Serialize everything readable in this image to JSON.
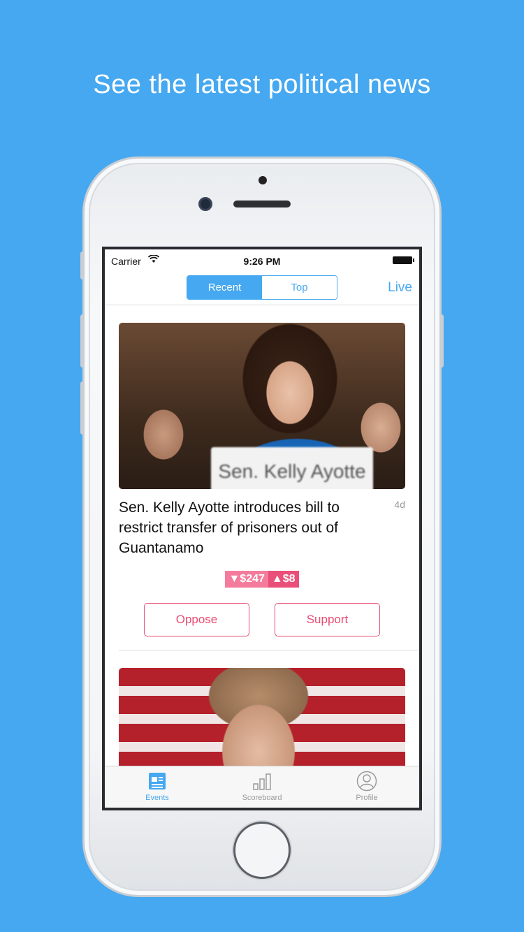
{
  "promo": {
    "headline": "See the latest political news"
  },
  "status_bar": {
    "carrier": "Carrier",
    "time": "9:26 PM"
  },
  "nav": {
    "segments": [
      "Recent",
      "Top"
    ],
    "selected": "Recent",
    "live_label": "Live"
  },
  "feed": [
    {
      "nameplate": "Sen. Kelly Ayotte",
      "title": "Sen. Kelly Ayotte introduces bill to restrict transfer of prisoners out of Guantanamo",
      "age": "4d",
      "oppose_amount": "▼$247",
      "support_amount": "▲$8",
      "oppose_label": "Oppose",
      "support_label": "Support"
    },
    {
      "image": "senator-photo"
    }
  ],
  "tab_bar": {
    "tabs": [
      {
        "label": "Events",
        "icon": "newspaper-icon",
        "active": true
      },
      {
        "label": "Scoreboard",
        "icon": "bar-chart-icon",
        "active": false
      },
      {
        "label": "Profile",
        "icon": "person-icon",
        "active": false
      }
    ]
  },
  "colors": {
    "background": "#46a8f0",
    "accent": "#46a8f0",
    "oppose_pink": "#f47b9b",
    "support_pink": "#ea4f79",
    "button_border": "#e84c72"
  }
}
